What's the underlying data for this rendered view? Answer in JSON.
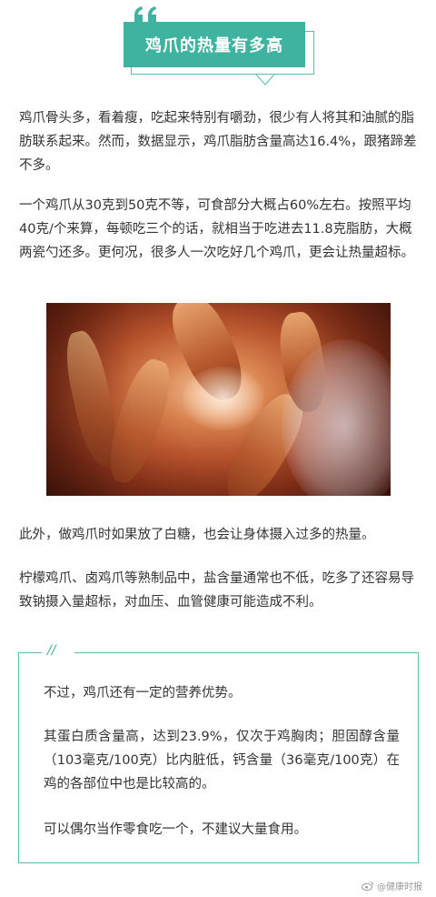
{
  "header": {
    "title": "鸡爪的热量有多高",
    "quote_mark": "quote-icon",
    "accent_color": "#3fb39f"
  },
  "body": {
    "paragraphs": [
      "鸡爪骨头多，看着瘦，吃起来特别有嚼劲，很少有人将其和油腻的脂肪联系起来。然而，数据显示，鸡爪脂肪含量高达16.4%，跟猪蹄差不多。",
      "一个鸡爪从30克到50克不等，可食部分大概占60%左右。按照平均40克/个来算，每顿吃三个的话，就相当于吃进去11.8克脂肪，大概两瓷勺还多。更何况，很多人一次吃好几个鸡爪，更会让热量超标。",
      "此外，做鸡爪时如果放了白糖，也会让身体摄入过多的热量。",
      "柠檬鸡爪、卤鸡爪等熟制品中，盐含量通常也不低，吃多了还容易导致钠摄入量超标，对血压、血管健康可能造成不利。"
    ]
  },
  "photo": {
    "subject": "braised chicken feet"
  },
  "tip_box": {
    "marker": "//",
    "paragraphs": [
      "不过，鸡爪还有一定的营养优势。",
      "其蛋白质含量高，达到23.9%，仅次于鸡胸肉；胆固醇含量（103毫克/100克）比内脏低，钙含量（36毫克/100克）在鸡的各部位中也是比较高的。",
      "可以偶尔当作零食吃一个，不建议大量食用。"
    ]
  },
  "watermark": {
    "text": "@健康时报",
    "icon": "weibo-icon"
  }
}
